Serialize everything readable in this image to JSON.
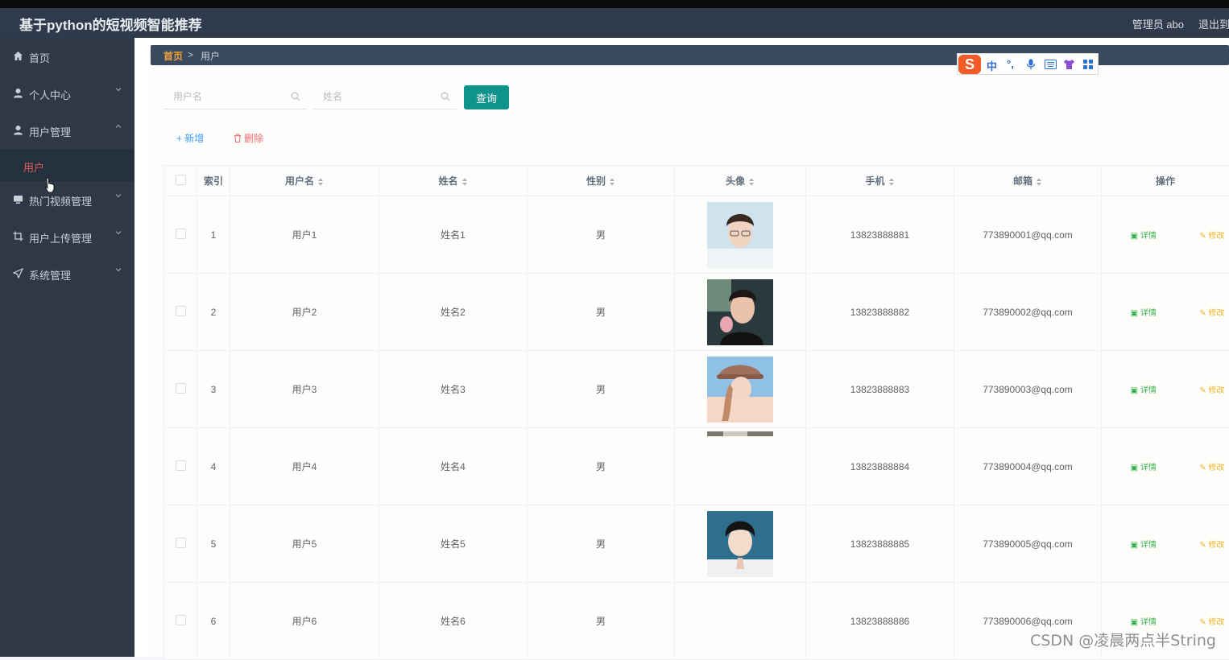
{
  "header": {
    "title": "基于python的短视频智能推荐",
    "admin": "管理员 abo",
    "logout": "退出到"
  },
  "sidebar": {
    "items": [
      {
        "label": "首页",
        "icon": "home-icon"
      },
      {
        "label": "个人中心",
        "icon": "user-icon"
      },
      {
        "label": "用户管理",
        "icon": "user-icon"
      },
      {
        "label": "用户",
        "icon": ""
      },
      {
        "label": "热门视频管理",
        "icon": "monitor-icon"
      },
      {
        "label": "用户上传管理",
        "icon": "crop-icon"
      },
      {
        "label": "系统管理",
        "icon": "send-icon"
      }
    ]
  },
  "breadcrumb": {
    "home": "首页",
    "sep": ">",
    "current": "用户"
  },
  "ime": {
    "logo": "S",
    "lang": "中",
    "punct": "°,"
  },
  "search": {
    "username_placeholder": "用户名",
    "name_placeholder": "姓名",
    "query": "查询"
  },
  "toolbar": {
    "add": "+ 新增",
    "delete": "删除"
  },
  "table": {
    "columns": [
      "索引",
      "用户名",
      "姓名",
      "性别",
      "头像",
      "手机",
      "邮箱",
      "操作"
    ],
    "actions": {
      "detail": "详情",
      "edit": "修改"
    },
    "rows": [
      {
        "index": "1",
        "username": "用户1",
        "name": "姓名1",
        "gender": "男",
        "phone": "13823888881",
        "email": "773890001@qq.com"
      },
      {
        "index": "2",
        "username": "用户2",
        "name": "姓名2",
        "gender": "男",
        "phone": "13823888882",
        "email": "773890002@qq.com"
      },
      {
        "index": "3",
        "username": "用户3",
        "name": "姓名3",
        "gender": "男",
        "phone": "13823888883",
        "email": "773890003@qq.com"
      },
      {
        "index": "4",
        "username": "用户4",
        "name": "姓名4",
        "gender": "男",
        "phone": "13823888884",
        "email": "773890004@qq.com"
      },
      {
        "index": "5",
        "username": "用户5",
        "name": "姓名5",
        "gender": "男",
        "phone": "13823888885",
        "email": "773890005@qq.com"
      },
      {
        "index": "6",
        "username": "用户6",
        "name": "姓名6",
        "gender": "男",
        "phone": "13823888886",
        "email": "773890006@qq.com"
      }
    ]
  },
  "watermark": "CSDN @凌晨两点半String",
  "colors": {
    "sidebar": "#2e3846",
    "header": "#2f3a4a",
    "accent": "#10938a",
    "active": "#e05c5c",
    "detail": "#37b34a",
    "edit": "#f0b429"
  }
}
